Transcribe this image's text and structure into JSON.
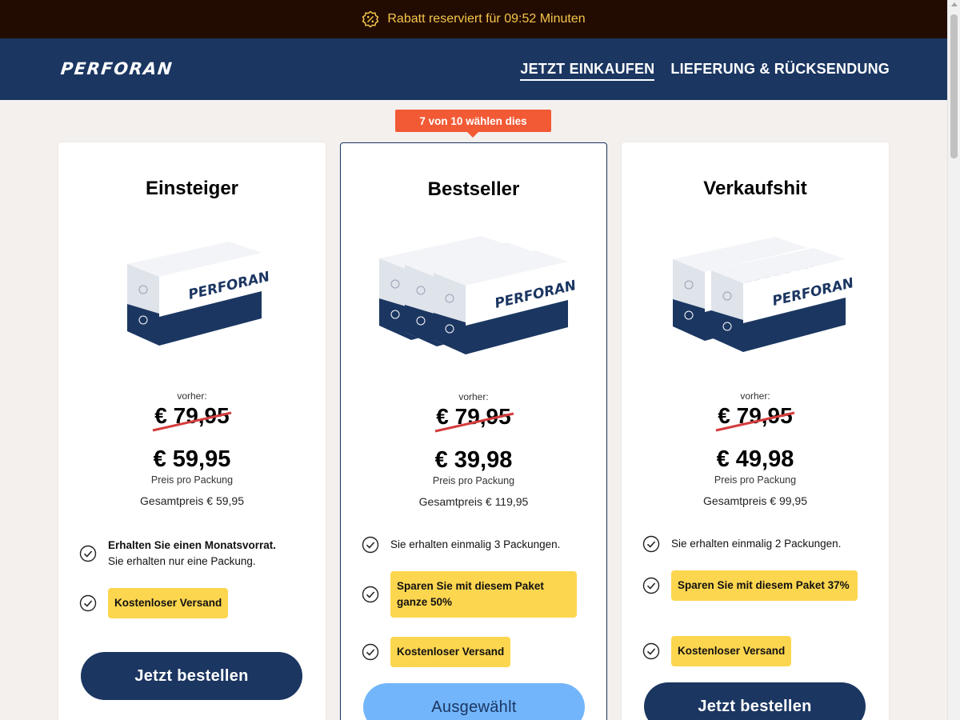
{
  "promo": {
    "text": "Rabatt reserviert für 09:52 Minuten",
    "icon": "discount-badge-icon"
  },
  "header": {
    "logo": "PERFORAN",
    "nav": [
      {
        "label": "JETZT EINKAUFEN",
        "active": true
      },
      {
        "label": "LIEFERUNG & RÜCKSENDUNG",
        "active": false
      }
    ]
  },
  "colors": {
    "promo_bg": "#220c02",
    "promo_text": "#f5c64a",
    "header_bg": "#1b3661",
    "badge_bg": "#f25a35",
    "highlight_bg": "#fdd64f",
    "selected_button": "#72b5fb",
    "page_bg": "#f4f0ee"
  },
  "badge": "7 von 10 wählen dies",
  "plans": [
    {
      "title": "Einsteiger",
      "boxes": 1,
      "was_label": "vorher:",
      "old_price": "€ 79,95",
      "price": "€ 59,95",
      "per_pack": "Preis pro Packung",
      "total": "Gesamtpreis € 59,95",
      "features": [
        {
          "bold": "Erhalten Sie einen Monatsvorrat.",
          "text": "Sie erhalten nur eine Packung."
        },
        {
          "highlight": "Kostenloser Versand"
        }
      ],
      "button": "Jetzt bestellen"
    },
    {
      "title": "Bestseller",
      "boxes": 3,
      "was_label": "vorher:",
      "old_price": "€ 79,95",
      "price": "€ 39,98",
      "per_pack": "Preis pro Packung",
      "total": "Gesamtpreis € 119,95",
      "features": [
        {
          "text": "Sie erhalten einmalig 3 Packungen."
        },
        {
          "highlight": "Sparen Sie mit diesem Paket ganze 50%"
        },
        {
          "highlight": "Kostenloser Versand"
        }
      ],
      "button": "Ausgewählt"
    },
    {
      "title": "Verkaufshit",
      "boxes": 2,
      "was_label": "vorher:",
      "old_price": "€ 79,95",
      "price": "€ 49,98",
      "per_pack": "Preis pro Packung",
      "total": "Gesamtpreis € 99,95",
      "features": [
        {
          "text": "Sie erhalten einmalig 2 Packungen."
        },
        {
          "highlight": "Sparen Sie mit diesem Paket 37%"
        },
        {
          "highlight": "Kostenloser Versand"
        }
      ],
      "button": "Jetzt bestellen"
    }
  ]
}
